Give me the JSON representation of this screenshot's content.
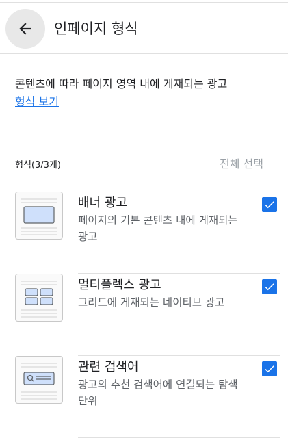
{
  "header": {
    "back_icon": "arrow-back-icon",
    "title": "인페이지 형식"
  },
  "description": {
    "text": "콘텐츠에 따라 페이지 영역 내에 게재되는 광고",
    "link": "형식 보기"
  },
  "section": {
    "label": "형식(3/3개)",
    "select_all": "전체 선택"
  },
  "formats": [
    {
      "title": "배너 광고",
      "desc": "페이지의 기본 콘텐츠 내에 게재되는 광고",
      "checked": true,
      "icon": "banner-ad-thumbnail-icon"
    },
    {
      "title": "멀티플렉스 광고",
      "desc": "그리드에 게재되는 네이티브 광고",
      "checked": true,
      "icon": "multiplex-ad-thumbnail-icon"
    },
    {
      "title": "관련 검색어",
      "desc": "광고의 추천 검색어에 연결되는 탐색 단위",
      "checked": true,
      "icon": "related-search-thumbnail-icon"
    }
  ],
  "colors": {
    "accent": "#1a73e8",
    "muted": "#9aa0a6",
    "divider": "#e0e0e0"
  }
}
